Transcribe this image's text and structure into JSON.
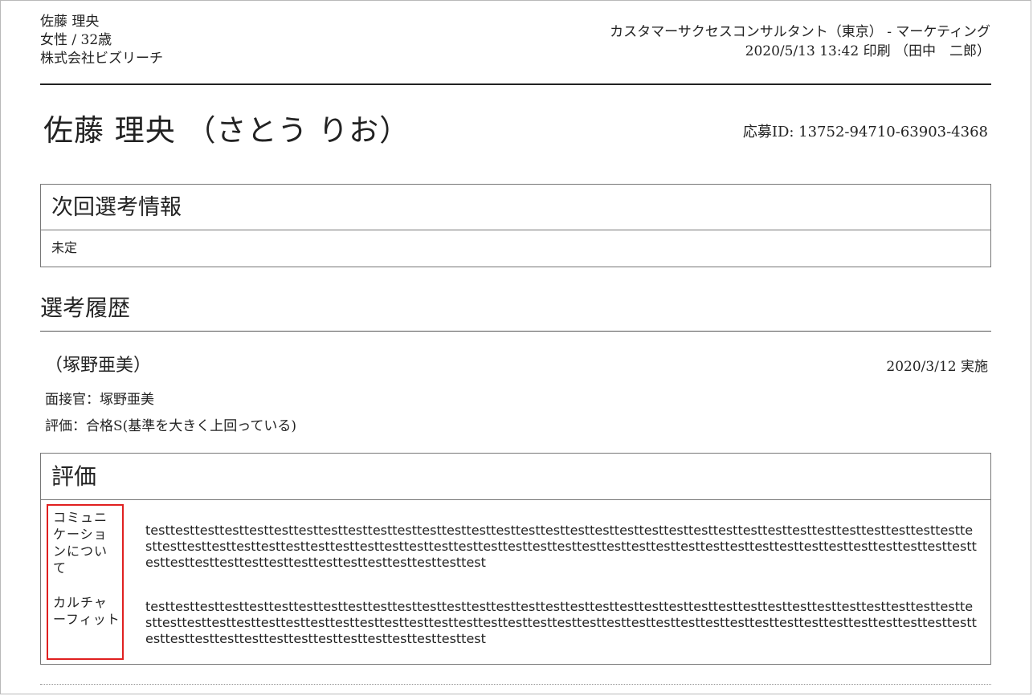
{
  "header": {
    "candidate_name": "佐藤 理央",
    "gender_age": "女性 / 32歳",
    "company": "株式会社ビズリーチ",
    "position": "カスタマーサクセスコンサルタント（東京） - マーケティング",
    "print_info": "2020/5/13 13:42 印刷 （田中　二郎）"
  },
  "candidate": {
    "full_name": "佐藤 理央 （さとう りお）",
    "application_id": "応募ID: 13752-94710-63903-4368"
  },
  "next_selection": {
    "title": "次回選考情報",
    "value": "未定"
  },
  "history": {
    "title": "選考履歴",
    "entry": {
      "name": "（塚野亜美）",
      "date": "2020/3/12 実施",
      "interviewer": "面接官：塚野亜美",
      "rating": "評価：合格S(基準を大きく上回っている)"
    }
  },
  "evaluation": {
    "title": "評価",
    "items": [
      {
        "category": "コミュニケーションについて",
        "text": "testtesttesttesttesttesttesttesttesttesttesttesttesttesttesttesttesttesttesttesttesttesttesttesttesttesttesttesttesttesttesttesttesttesttesttesttesttesttesttesttesttesttesttesttesttesttesttesttesttesttesttesttesttesttesttesttesttesttesttesttesttesttesttesttesttesttesttesttesttesttesttesttesttesttesttesttesttesttesttesttest"
      },
      {
        "category": "カルチャーフィット",
        "text": "testtesttesttesttesttesttesttesttesttesttesttesttesttesttesttesttesttesttesttesttesttesttesttesttesttesttesttesttesttesttesttesttesttesttesttesttesttesttesttesttesttesttesttesttesttesttesttesttesttesttesttesttesttesttesttesttesttesttesttesttesttesttesttesttesttesttesttesttesttesttesttesttesttesttesttesttesttesttesttesttest"
      }
    ]
  },
  "colors": {
    "highlight_border": "#e02020",
    "text": "#222222",
    "box_border": "#777777"
  }
}
